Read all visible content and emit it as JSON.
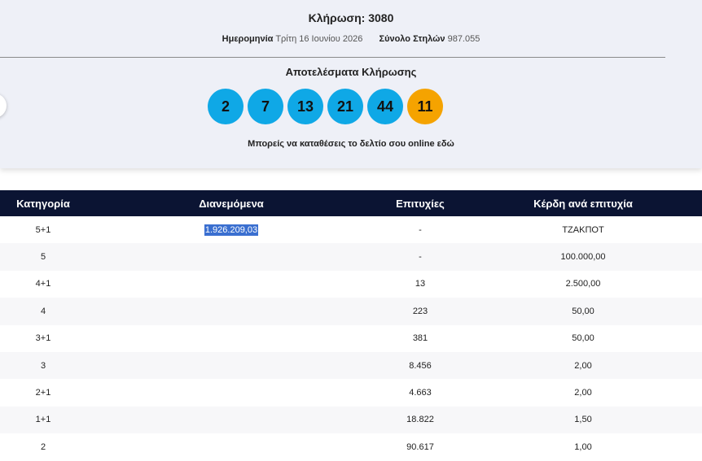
{
  "draw": {
    "title": "Κλήρωση: 3080",
    "date_label": "Ημερομηνία",
    "date_value": "Τρίτη 16 Ιουνίου 2026",
    "columns_label": "Σύνολο Στηλών",
    "columns_value": "987.055"
  },
  "results": {
    "title": "Αποτελέσματα Κλήρωσης",
    "numbers": [
      "2",
      "7",
      "13",
      "21",
      "44"
    ],
    "bonus": "11",
    "online_text": "Μπορείς να καταθέσεις το δελτίο σου online εδώ"
  },
  "colors": {
    "ball": "#0fa8e6",
    "bonus_ball": "#f5a300",
    "table_header": "#0b1433",
    "selection": "#3a6fd0"
  },
  "table": {
    "headers": [
      "Κατηγορία",
      "Διανεμόμενα",
      "Επιτυχίες",
      "Κέρδη ανά επιτυχία"
    ],
    "rows": [
      {
        "category": "5+1",
        "distributed": "1.926.209,03",
        "winners": "-",
        "prize": "ΤΖΑΚΠΟΤ"
      },
      {
        "category": "5",
        "distributed": "",
        "winners": "-",
        "prize": "100.000,00"
      },
      {
        "category": "4+1",
        "distributed": "",
        "winners": "13",
        "prize": "2.500,00"
      },
      {
        "category": "4",
        "distributed": "",
        "winners": "223",
        "prize": "50,00"
      },
      {
        "category": "3+1",
        "distributed": "",
        "winners": "381",
        "prize": "50,00"
      },
      {
        "category": "3",
        "distributed": "",
        "winners": "8.456",
        "prize": "2,00"
      },
      {
        "category": "2+1",
        "distributed": "",
        "winners": "4.663",
        "prize": "2,00"
      },
      {
        "category": "1+1",
        "distributed": "",
        "winners": "18.822",
        "prize": "1,50"
      },
      {
        "category": "2",
        "distributed": "",
        "winners": "90.617",
        "prize": "1,00"
      }
    ]
  }
}
